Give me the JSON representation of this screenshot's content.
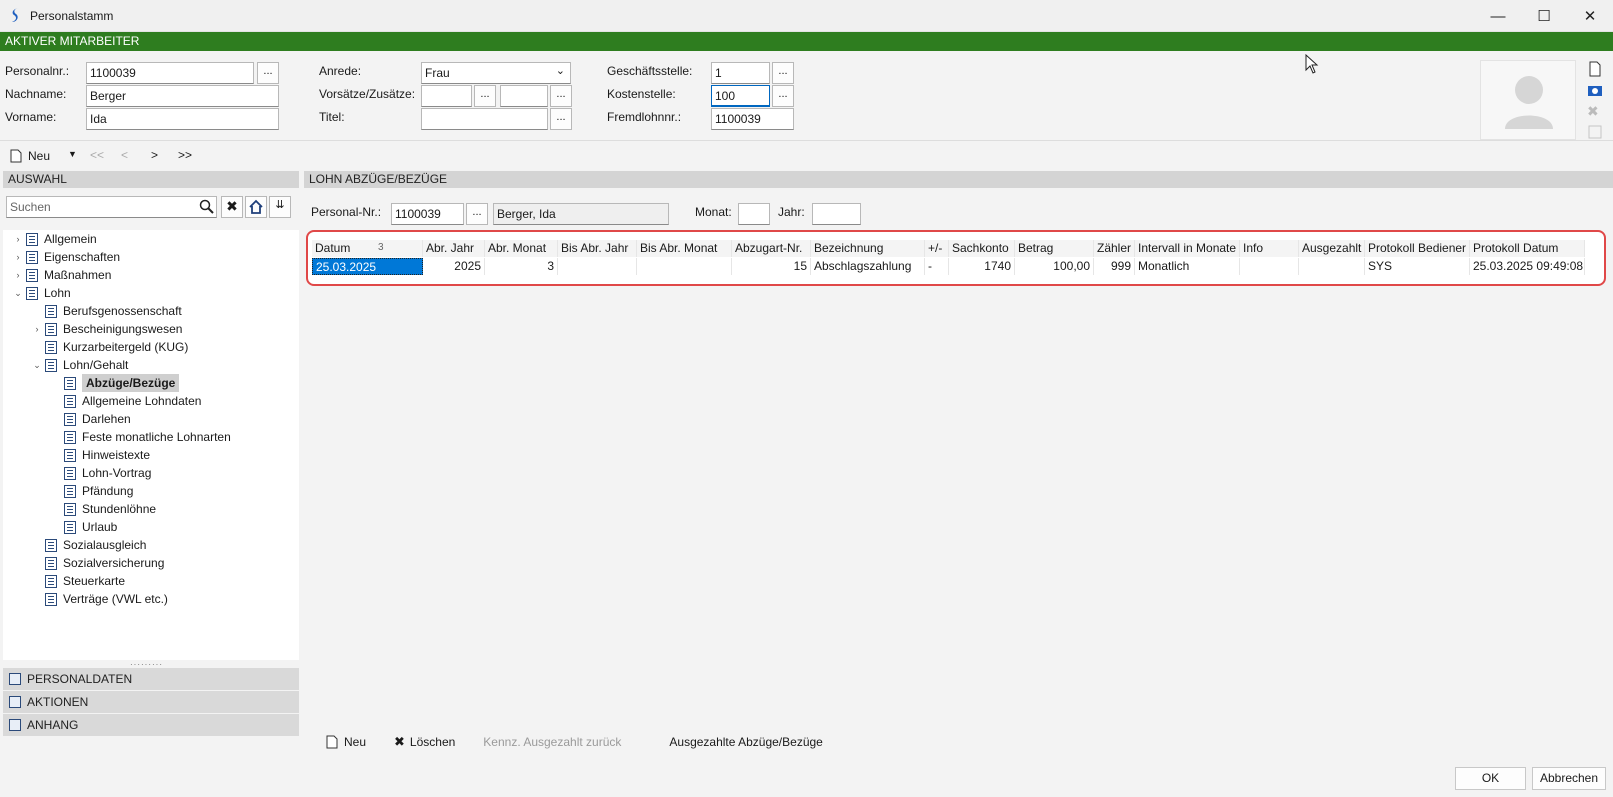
{
  "window": {
    "title": "Personalstamm",
    "minimize": "—",
    "maximize": "☐",
    "close": "✕"
  },
  "banner": "AKTIVER MITARBEITER",
  "header": {
    "personalnr_label": "Personalnr.:",
    "personalnr": "1100039",
    "nachname_label": "Nachname:",
    "nachname": "Berger",
    "vorname_label": "Vorname:",
    "vorname": "Ida",
    "anrede_label": "Anrede:",
    "anrede": "Frau",
    "vorsaetze_label": "Vorsätze/Zusätze:",
    "vorsatz": "",
    "zusatz": "",
    "titel_label": "Titel:",
    "titel": "",
    "geschaeftsstelle_label": "Geschäftsstelle:",
    "geschaeftsstelle": "1",
    "kostenstelle_label": "Kostenstelle:",
    "kostenstelle": "100",
    "fremdlohnnr_label": "Fremdlohnnr.:",
    "fremdlohnnr": "1100039",
    "dots": "..."
  },
  "toolbar": {
    "neu": "Neu",
    "first": "<<",
    "prev": "<",
    "next": ">",
    "last": ">>"
  },
  "left": {
    "section_title": "AUSWAHL",
    "search_placeholder": "Suchen",
    "tree": [
      {
        "label": "Allgemein",
        "level": 0,
        "exp": "›"
      },
      {
        "label": "Eigenschaften",
        "level": 0,
        "exp": "›"
      },
      {
        "label": "Maßnahmen",
        "level": 0,
        "exp": "›"
      },
      {
        "label": "Lohn",
        "level": 0,
        "exp": "⌄"
      },
      {
        "label": "Berufsgenossenschaft",
        "level": 1,
        "exp": ""
      },
      {
        "label": "Bescheinigungswesen",
        "level": 1,
        "exp": "›"
      },
      {
        "label": "Kurzarbeitergeld (KUG)",
        "level": 1,
        "exp": ""
      },
      {
        "label": "Lohn/Gehalt",
        "level": 1,
        "exp": "⌄"
      },
      {
        "label": "Abzüge/Bezüge",
        "level": 2,
        "exp": "",
        "selected": true
      },
      {
        "label": "Allgemeine Lohndaten",
        "level": 2,
        "exp": ""
      },
      {
        "label": "Darlehen",
        "level": 2,
        "exp": ""
      },
      {
        "label": "Feste monatliche Lohnarten",
        "level": 2,
        "exp": ""
      },
      {
        "label": "Hinweistexte",
        "level": 2,
        "exp": ""
      },
      {
        "label": "Lohn-Vortrag",
        "level": 2,
        "exp": ""
      },
      {
        "label": "Pfändung",
        "level": 2,
        "exp": ""
      },
      {
        "label": "Stundenlöhne",
        "level": 2,
        "exp": ""
      },
      {
        "label": "Urlaub",
        "level": 2,
        "exp": ""
      },
      {
        "label": "Sozialausgleich",
        "level": 1,
        "exp": ""
      },
      {
        "label": "Sozialversicherung",
        "level": 1,
        "exp": ""
      },
      {
        "label": "Steuerkarte",
        "level": 1,
        "exp": ""
      },
      {
        "label": "Verträge (VWL etc.)",
        "level": 1,
        "exp": ""
      }
    ],
    "accordions": [
      "PERSONALDATEN",
      "AKTIONEN",
      "ANHANG"
    ]
  },
  "right": {
    "section_title": "LOHN ABZÜGE/BEZÜGE",
    "personalnr_label": "Personal-Nr.:",
    "personalnr": "1100039",
    "name": "Berger, Ida",
    "monat_label": "Monat:",
    "monat": "",
    "jahr_label": "Jahr:",
    "jahr": "",
    "columns": [
      "Datum",
      "Abr. Jahr",
      "Abr. Monat",
      "Bis Abr. Jahr",
      "Bis Abr. Monat",
      "Abzugart-Nr.",
      "Bezeichnung",
      "+/-",
      "Sachkonto",
      "Betrag",
      "Zähler",
      "Intervall in Monate",
      "Info",
      "Ausgezahlt",
      "Protokoll Bediener",
      "Protokoll Datum"
    ],
    "sort_marker": "3",
    "row": [
      "25.03.2025",
      "2025",
      "3",
      "",
      "",
      "15",
      "Abschlagszahlung",
      "-",
      "1740",
      "100,00",
      "999",
      "Monatlich",
      "",
      "",
      "SYS",
      "25.03.2025 09:49:08"
    ],
    "bottom": {
      "neu": "Neu",
      "loeschen": "Löschen",
      "kennz": "Kennz. Ausgezahlt zurück",
      "ausgezahlte": "Ausgezahlte Abzüge/Bezüge"
    }
  },
  "footer": {
    "ok": "OK",
    "abbrechen": "Abbrechen"
  },
  "colors": {
    "banner": "#2e7d1f",
    "highlight": "#e04848",
    "selection": "#0078d7"
  }
}
